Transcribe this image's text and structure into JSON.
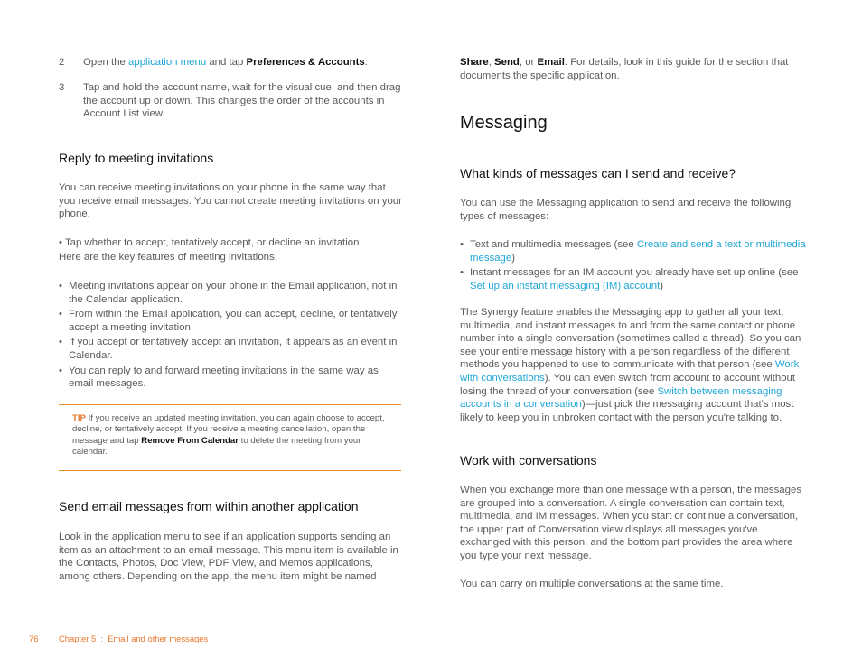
{
  "left": {
    "steps": [
      {
        "num": "2",
        "pre": "Open the ",
        "link": "application menu",
        "mid": " and tap ",
        "bold": "Preferences & Accounts",
        "post": "."
      },
      {
        "num": "3",
        "text": "Tap and hold the account name, wait for the visual cue, and then drag the account up or down. This changes the order of the accounts in Account List view."
      }
    ],
    "reply_heading": "Reply to meeting invitations",
    "reply_para": "You can receive meeting invitations on your phone in the same way that you receive email messages. You cannot create meeting invitations on your phone.",
    "tap_bullet": "Tap whether to accept, tentatively accept, or decline an invitation.",
    "features_intro": "Here are the key features of meeting invitations:",
    "features": [
      "Meeting invitations appear on your phone in the Email application, not in the Calendar application.",
      "From within the Email application, you can accept, decline, or tentatively accept a meeting invitation.",
      "If you accept or tentatively accept an invitation, it appears as an event in Calendar.",
      "You can reply to and forward meeting invitations in the same way as email messages."
    ],
    "tip": {
      "label": "TIP",
      "pre": " If you receive an updated meeting invitation, you can again choose to accept, decline, or tentatively accept. If you receive a meeting cancellation, open the message and tap ",
      "bold": "Remove From Calendar",
      "post": " to delete the meeting from your calendar."
    },
    "send_heading": "Send email messages from within another application",
    "send_para": "Look in the application menu to see if an application supports sending an item as an attachment to an email message. This menu item is available in the Contacts, Photos, Doc View, PDF View, and Memos applications, among others. Depending on the app, the menu item might be named"
  },
  "right": {
    "cont": {
      "b1": "Share",
      "s1": ", ",
      "b2": "Send",
      "s2": ", or ",
      "b3": "Email",
      "post": ". For details, look in this guide for the section that documents the specific application."
    },
    "messaging_title": "Messaging",
    "kinds_heading": "What kinds of messages can I send and receive?",
    "kinds_para": "You can use the Messaging application to send and receive the following types of messages:",
    "kinds_bullets": [
      {
        "pre": "Text and multimedia messages (see ",
        "link": "Create and send a text or multimedia message",
        "post": ")"
      },
      {
        "pre": "Instant messages for an IM account you already have set up online (see ",
        "link": "Set up an instant messaging (IM) account",
        "post": ")"
      }
    ],
    "synergy": {
      "p1": "The Synergy feature enables the Messaging app to gather all your text, multimedia, and instant messages to and from the same contact or phone number into a single conversation (sometimes called a thread). So you can see your entire message history with a person regardless of the different methods you happened to use to communicate with that person (see ",
      "l1": "Work with conversations",
      "p2": "). You can even switch from account to account without losing the thread of your conversation (see ",
      "l2": "Switch between messaging accounts in a conversation",
      "p3": ")—just pick the messaging account that's most likely to keep you in unbroken contact with the person you're talking to."
    },
    "work_heading": "Work with conversations",
    "work_para": "When you exchange more than one message with a person, the messages are grouped into a conversation. A single conversation can contain text, multimedia, and IM messages. When you start or continue a conversation, the upper part of Conversation view displays all messages you've exchanged with this person, and the bottom part provides the area where you type your next message.",
    "carry_para": "You can carry on multiple conversations at the same time."
  },
  "footer": {
    "page": "76",
    "chapter": "Chapter 5  :  Email and other messages"
  },
  "colors": {
    "link": "#1fa6d6",
    "accent": "#e8762c",
    "text": "#5a5a5a",
    "heading": "#111111"
  }
}
